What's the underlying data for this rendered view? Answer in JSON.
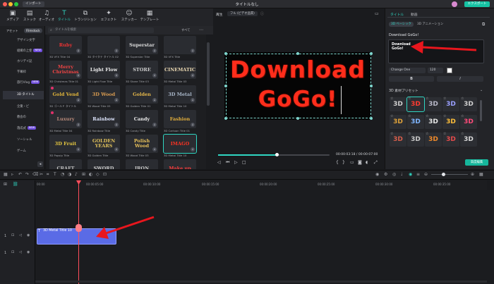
{
  "titlebar": {
    "import_label": "インポート",
    "title": "タイトルなし",
    "export_label": "エクスポート"
  },
  "toolbar": {
    "tools": [
      {
        "label": "メディア",
        "icon": "media-icon"
      },
      {
        "label": "ストック",
        "icon": "stock-icon"
      },
      {
        "label": "オーディオ",
        "icon": "audio-icon"
      },
      {
        "label": "タイトル",
        "icon": "title-icon"
      },
      {
        "label": "トランジション",
        "icon": "transition-icon"
      },
      {
        "label": "エフェクト",
        "icon": "effect-icon"
      },
      {
        "label": "ステッカー",
        "icon": "sticker-icon"
      },
      {
        "label": "テンプレート",
        "icon": "template-icon"
      }
    ]
  },
  "library": {
    "tab_asset": "アセット",
    "tab_filmstock": "Filmstock",
    "search_placeholder": "タイトルを検索",
    "filter_label": "すべて",
    "categories": [
      {
        "label": "デザイン文字",
        "badge": ""
      },
      {
        "label": "組織の上使",
        "badge": "NEW"
      },
      {
        "label": "ホリデイ記",
        "badge": ""
      },
      {
        "label": "字幕枠",
        "badge": ""
      },
      {
        "label": "旅行Vlog",
        "badge": "NEW"
      },
      {
        "label": "3D タイトル",
        "badge": ""
      },
      {
        "label": "企業・ビ",
        "badge": ""
      },
      {
        "label": "教会の",
        "badge": ""
      },
      {
        "label": "落成式",
        "badge": "NEW"
      },
      {
        "label": "ソーシャル",
        "badge": ""
      },
      {
        "label": "ゲーム",
        "badge": ""
      }
    ],
    "cards": [
      {
        "thumb": "Ruby",
        "caption": "3D VFX Title 04",
        "color": "#e33"
      },
      {
        "thumb": "",
        "caption": "3D タイタテ タイトル 02",
        "color": "#aaa"
      },
      {
        "thumb": "Superstar",
        "caption": "3D Superstar Title",
        "color": "#ddd"
      },
      {
        "thumb": "",
        "caption": "3D VFX Title",
        "color": "#c33"
      },
      {
        "thumb": "Merry Christmas",
        "caption": "3D Christmas Title 01",
        "color": "#e44"
      },
      {
        "thumb": "Light Flow",
        "caption": "3D Light Flow Title",
        "color": "#eee"
      },
      {
        "thumb": "STORE",
        "caption": "3D Stone Title 03",
        "color": "#ccc"
      },
      {
        "thumb": "CINEMATIC",
        "caption": "3D Metal Title 03",
        "color": "#e8d6b0"
      },
      {
        "thumb": "Gold Vend",
        "caption": "3D ゴールド タイトル",
        "color": "#e0b43a"
      },
      {
        "thumb": "3D Wood",
        "caption": "3D Wood Title 05",
        "color": "#d89b50"
      },
      {
        "thumb": "Golden",
        "caption": "3D Golden Title 01",
        "color": "#e3b64a"
      },
      {
        "thumb": "3D Metal",
        "caption": "3D Metal Title 10",
        "color": "#a9b7c9"
      },
      {
        "thumb": "Luxury",
        "caption": "3D Metal Title 04",
        "color": "#b98a7a"
      },
      {
        "thumb": "Rainbow",
        "caption": "3D Rainbow Title",
        "color": "#dfe6ff"
      },
      {
        "thumb": "Candy",
        "caption": "3D Candy Title",
        "color": "#eee"
      },
      {
        "thumb": "Fashion",
        "caption": "3D Cartoon Title 01",
        "color": "#e4b03c"
      },
      {
        "thumb": "3D Fruit",
        "caption": "3D Popsip Title",
        "color": "#e4c640"
      },
      {
        "thumb": "GOLDEN YEARS",
        "caption": "3D Golden Title",
        "color": "#e0c05a"
      },
      {
        "thumb": "Polish Wood",
        "caption": "3D Wood Title 03",
        "color": "#e7c05a"
      },
      {
        "thumb": "IMAGO",
        "caption": "3D Metal Title 10",
        "color": "#ff3322"
      },
      {
        "thumb": "CRAFT",
        "caption": "",
        "color": "#bfbfbf"
      },
      {
        "thumb": "SWORD",
        "caption": "",
        "color": "#cfcfcf"
      },
      {
        "thumb": "IRON",
        "caption": "",
        "color": "#c6c6c6"
      },
      {
        "thumb": "Make up",
        "caption": "",
        "color": "#ff3c3c"
      }
    ]
  },
  "player": {
    "tab_label": "再生",
    "quality": "フル (ビデオ品質)",
    "preview_line1": "Download",
    "preview_line2": "GoGo!",
    "current_time": "00:00:03:18",
    "total_time": "00:00:07:00",
    "time_sep": "/",
    "progress": 0.53
  },
  "inspector": {
    "tab_title": "タイトル",
    "tab_video": "動画",
    "sub_basic": "3D ベーシック",
    "sub_anim": "3D アニメーション",
    "heading": "Download GoGo!",
    "text_value": "Download\nGoGo!",
    "font": "Change One",
    "size": "120",
    "bold": "B",
    "italic": "I",
    "preset_label": "3D 素材プリセット",
    "preset_text": "3D",
    "ok_label": "高度編集"
  },
  "timeline": {
    "ruler": [
      "00:00",
      "00:00:05:00",
      "00:00:10:00",
      "00:00:15:00",
      "00:00:20:00",
      "00:00:25:00",
      "00:00:30:00",
      "00:00:35:00",
      "00:00:40:00",
      "00:00:45:00"
    ],
    "track_labels": [
      "1",
      "1"
    ],
    "clip_label": "3D Metal Title 10"
  }
}
